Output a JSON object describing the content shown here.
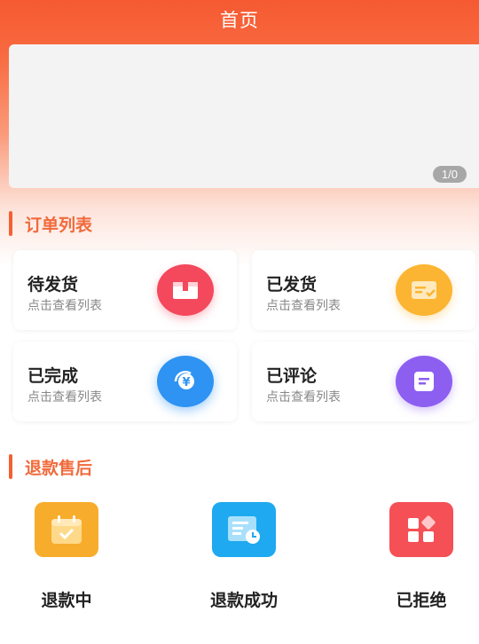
{
  "header": {
    "title": "首页"
  },
  "banner": {
    "pager": "1/0"
  },
  "orders": {
    "title": "订单列表",
    "items": [
      {
        "label": "待发货",
        "sub": "点击查看列表",
        "icon": "box-icon",
        "color": "#f4485c"
      },
      {
        "label": "已发货",
        "sub": "点击查看列表",
        "icon": "card-check-icon",
        "color": "#fbb532"
      },
      {
        "label": "已完成",
        "sub": "点击查看列表",
        "icon": "yen-cycle-icon",
        "color": "#2e93f2"
      },
      {
        "label": "已评论",
        "sub": "点击查看列表",
        "icon": "comment-doc-icon",
        "color": "#8d5ff1"
      }
    ]
  },
  "refunds": {
    "title": "退款售后",
    "items": [
      {
        "label": "退款中",
        "icon": "calendar-check-icon",
        "color": "#f8ac2b"
      },
      {
        "label": "退款成功",
        "icon": "document-clock-icon",
        "color": "#1ea9f0"
      },
      {
        "label": "已拒绝",
        "icon": "app-grid-icon",
        "color": "#f45055"
      }
    ]
  }
}
